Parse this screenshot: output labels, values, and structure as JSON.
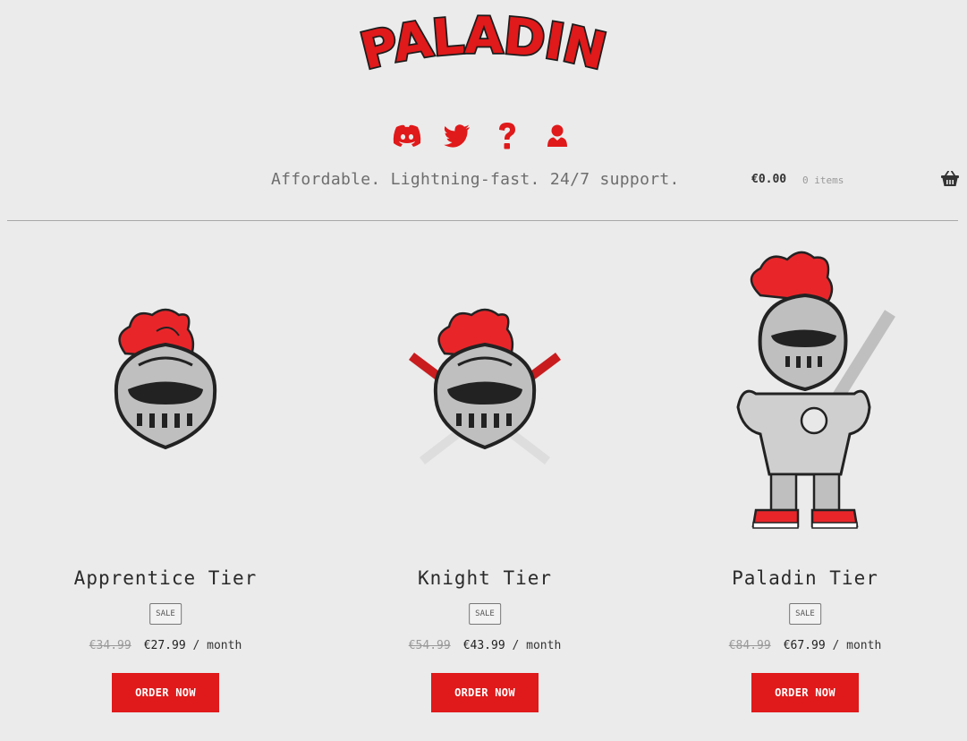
{
  "brand": {
    "logo_text": "PALADIN",
    "accent": "#e0191a"
  },
  "social": [
    {
      "name": "discord-icon"
    },
    {
      "name": "twitter-icon"
    },
    {
      "name": "help-icon"
    },
    {
      "name": "account-icon"
    }
  ],
  "header": {
    "tagline": "Affordable. Lightning-fast. 24/7 support.",
    "cart_total": "€0.00",
    "cart_count": "0 items",
    "cart_icon": "basket-icon"
  },
  "products": [
    {
      "title": "Apprentice Tier",
      "badge": "SALE",
      "old_price": "€34.99",
      "price": "€27.99",
      "period": " / month",
      "cta": "ORDER NOW",
      "image": "knight-helmet"
    },
    {
      "title": "Knight Tier",
      "badge": "SALE",
      "old_price": "€54.99",
      "price": "€43.99",
      "period": " / month",
      "cta": "ORDER NOW",
      "image": "knight-helmet-swords"
    },
    {
      "title": "Paladin Tier",
      "badge": "SALE",
      "old_price": "€84.99",
      "price": "€67.99",
      "period": " / month",
      "cta": "ORDER NOW",
      "image": "knight-full-armor"
    }
  ]
}
